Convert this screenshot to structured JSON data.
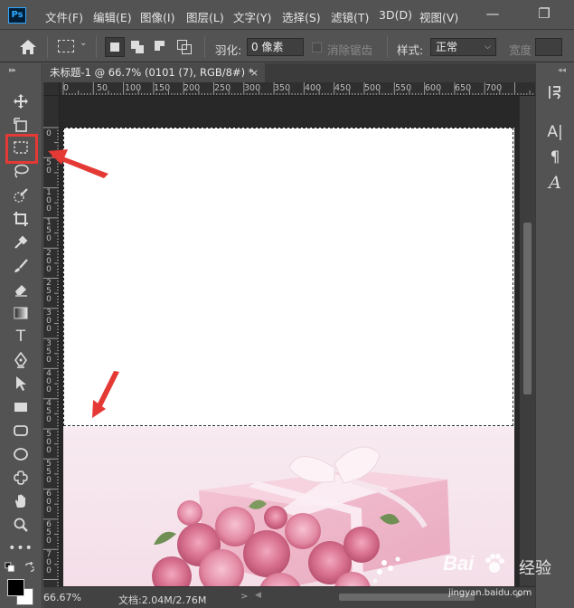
{
  "app": {
    "logo": "Ps",
    "menu": [
      "文件(F)",
      "编辑(E)",
      "图像(I)",
      "图层(L)",
      "文字(Y)",
      "选择(S)",
      "滤镜(T)",
      "3D(D)",
      "视图(V)"
    ],
    "window_controls": [
      "minimize-icon",
      "restore-icon"
    ]
  },
  "options": {
    "feather_label": "羽化:",
    "feather_value": "0 像素",
    "antialias_label": "消除锯齿",
    "style_label": "样式:",
    "style_value": "正常",
    "width_label": "宽度"
  },
  "document": {
    "tab_title": "未标题-1 @ 66.7% (0101 (7), RGB/8#) *",
    "tab_close": "×"
  },
  "rulers": {
    "top": [
      "0",
      "50",
      "100",
      "150",
      "200",
      "250",
      "300",
      "350",
      "400",
      "450",
      "500",
      "550",
      "600",
      "650",
      "700"
    ],
    "left": [
      "0",
      "5 0",
      "1 0 0",
      "1 5 0",
      "2 0 0",
      "2 5 0",
      "3 0 0",
      "3 5 0",
      "4 0 0",
      "4 5 0",
      "5 0 0",
      "5 5 0",
      "6 0 0",
      "6 5 0",
      "7 0 0"
    ]
  },
  "tools": [
    "move-tool",
    "artboard-tool",
    "rectangular-marquee-tool",
    "lasso-tool",
    "quick-selection-tool",
    "crop-tool",
    "eyedropper-tool",
    "brush-tool",
    "eraser-tool",
    "gradient-tool",
    "type-tool",
    "pen-tool",
    "path-selection-tool",
    "rectangle-tool",
    "rounded-rectangle-tool",
    "ellipse-tool",
    "custom-shape-tool",
    "hand-tool",
    "zoom-tool",
    "more-tools"
  ],
  "selected_tool": "rectangular-marquee-tool",
  "right_panel": {
    "glyphs": [
      "A|",
      "¶",
      "A"
    ]
  },
  "status": {
    "zoom": "66.67%",
    "doc_size": "文档:2.04M/2.76M",
    "caret": ">"
  },
  "watermark": {
    "brand": "Bai",
    "brand_suffix": "经验",
    "url": "jingyan.baidu.com"
  },
  "colors": {
    "foreground": "#000000",
    "background": "#ffffff",
    "annotation": "#e53935",
    "ps_blue": "#31a8ff"
  }
}
